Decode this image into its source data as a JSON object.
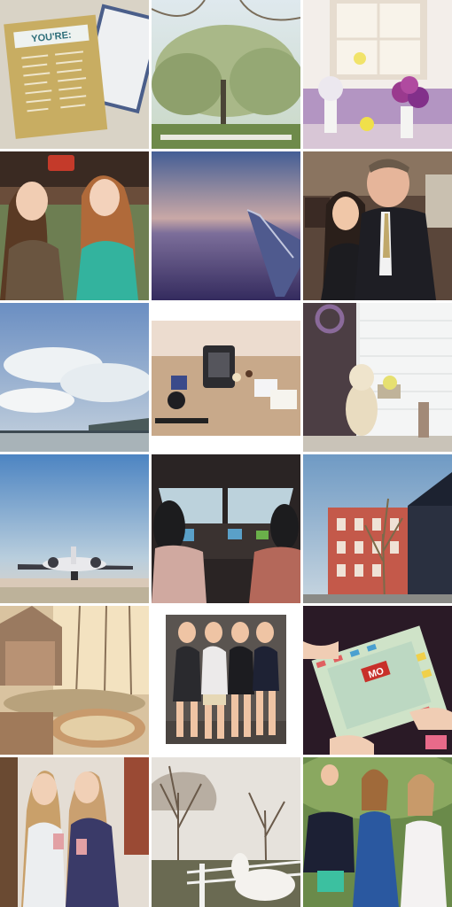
{
  "collage": {
    "card_heading": "YOU'RE:",
    "board_logo": "MO"
  }
}
